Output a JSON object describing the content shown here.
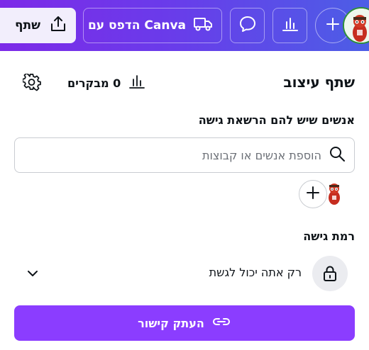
{
  "topbar": {
    "share_label": "שתף",
    "print_label": "הדפס עם Canva",
    "icons": [
      "share-upload-icon",
      "truck-icon",
      "comment-icon",
      "analytics-icon",
      "plus-icon"
    ]
  },
  "panel": {
    "title": "שתף עיצוב",
    "visitors_label": "0 מבקרים",
    "access_people_label": "אנשים שיש להם הרשאת גישה",
    "search": {
      "placeholder": "הוספת אנשים או קבוצות",
      "value": ""
    },
    "access_level_label": "רמת גישה",
    "access_level_value": "רק אתה יכול לגשת",
    "copy_link_label": "העתק קישור"
  },
  "colors": {
    "topbar_gradient_start": "#7d2ae8",
    "topbar_gradient_end": "#4c5ee6",
    "accent_button": "#8b3dff",
    "share_button_bg": "#f2eefc"
  }
}
